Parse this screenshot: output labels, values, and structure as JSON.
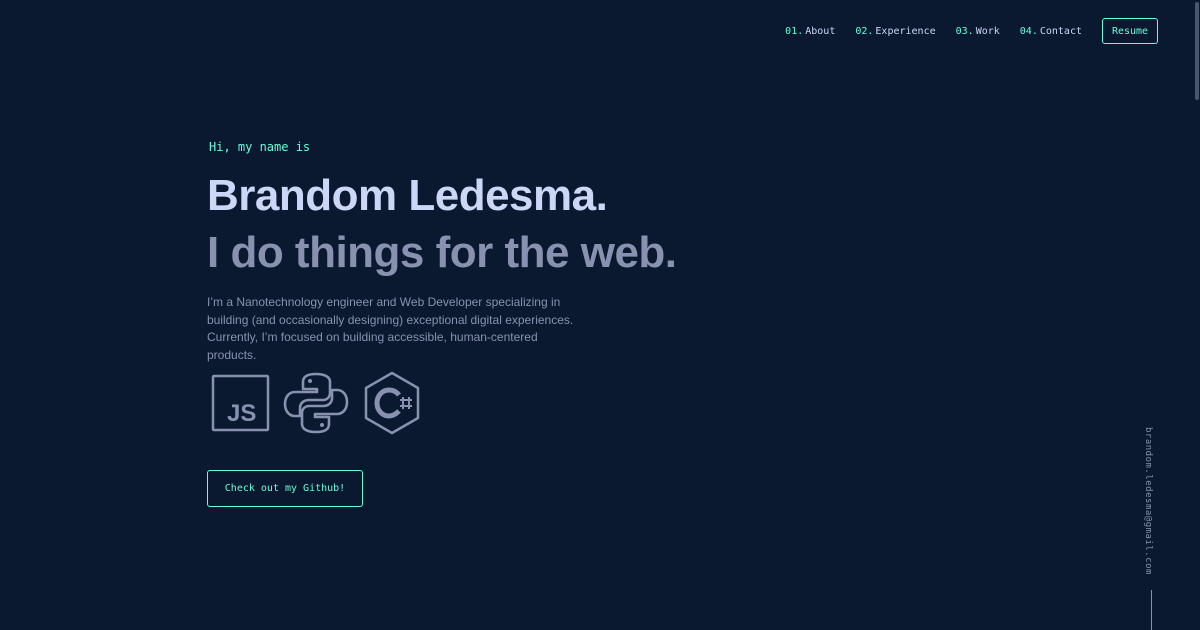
{
  "nav": {
    "items": [
      {
        "num": "01.",
        "label": "About"
      },
      {
        "num": "02.",
        "label": "Experience"
      },
      {
        "num": "03.",
        "label": "Work"
      },
      {
        "num": "04.",
        "label": "Contact"
      }
    ],
    "resume_label": "Resume"
  },
  "hero": {
    "greeting": "Hi, my name is",
    "name": "Brandom Ledesma.",
    "tagline": "I do things for the web.",
    "bio": "I’m a Nanotechnology engineer and Web Developer specializing in building (and occasionally designing) exceptional digital experiences. Currently, I’m focused on building accessible, human-centered products.",
    "tech_icons": [
      "javascript-icon",
      "python-icon",
      "csharp-icon"
    ],
    "cta_label": "Check out my Github!"
  },
  "side": {
    "email": "brandom.ledesma@gmail.com"
  },
  "colors": {
    "background": "#0a192f",
    "accent": "#64ffda",
    "heading": "#ccd6f6",
    "muted": "#8892b0"
  }
}
